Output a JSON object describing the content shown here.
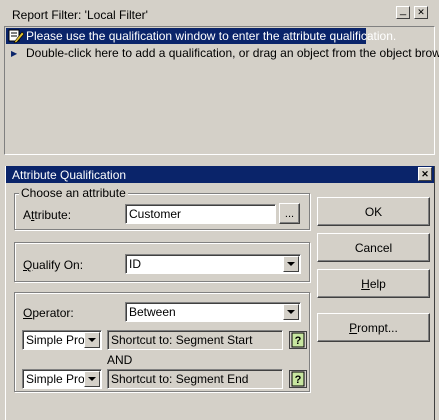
{
  "report_filter": {
    "title": "Report Filter: 'Local Filter'",
    "minimize_glyph": "_",
    "close_glyph": "✕",
    "rows": [
      {
        "text": "Please use the qualification window to enter the attribute qualification.",
        "icon": "filter-pencil-icon"
      },
      {
        "text": "Double-click here to add a qualification, or drag an object from the object browser.",
        "icon": "bullet-icon"
      }
    ]
  },
  "dialog": {
    "title": "Attribute Qualification",
    "close_glyph": "✕",
    "choose_group": {
      "legend": "Choose an attribute",
      "attribute_label_prefix": "A",
      "attribute_label_accel": "t",
      "attribute_label_suffix": "tribute:",
      "attribute_value": "Customer",
      "browse_label": "..."
    },
    "qualify": {
      "label_accel": "Q",
      "label_suffix": "ualify On:",
      "value": "ID"
    },
    "operator": {
      "label_accel": "O",
      "label_suffix": "perator:",
      "value": "Between"
    },
    "value_rows": [
      {
        "type": "Simple Prom",
        "shortcut": "Shortcut to: Segment Start"
      },
      {
        "type": "Simple Prom",
        "shortcut": "Shortcut to: Segment End"
      }
    ],
    "and_label": "AND",
    "buttons": {
      "ok": "OK",
      "cancel": "Cancel",
      "help_accel": "H",
      "help_suffix": "elp",
      "prompt_accel": "P",
      "prompt_suffix": "rompt..."
    }
  }
}
